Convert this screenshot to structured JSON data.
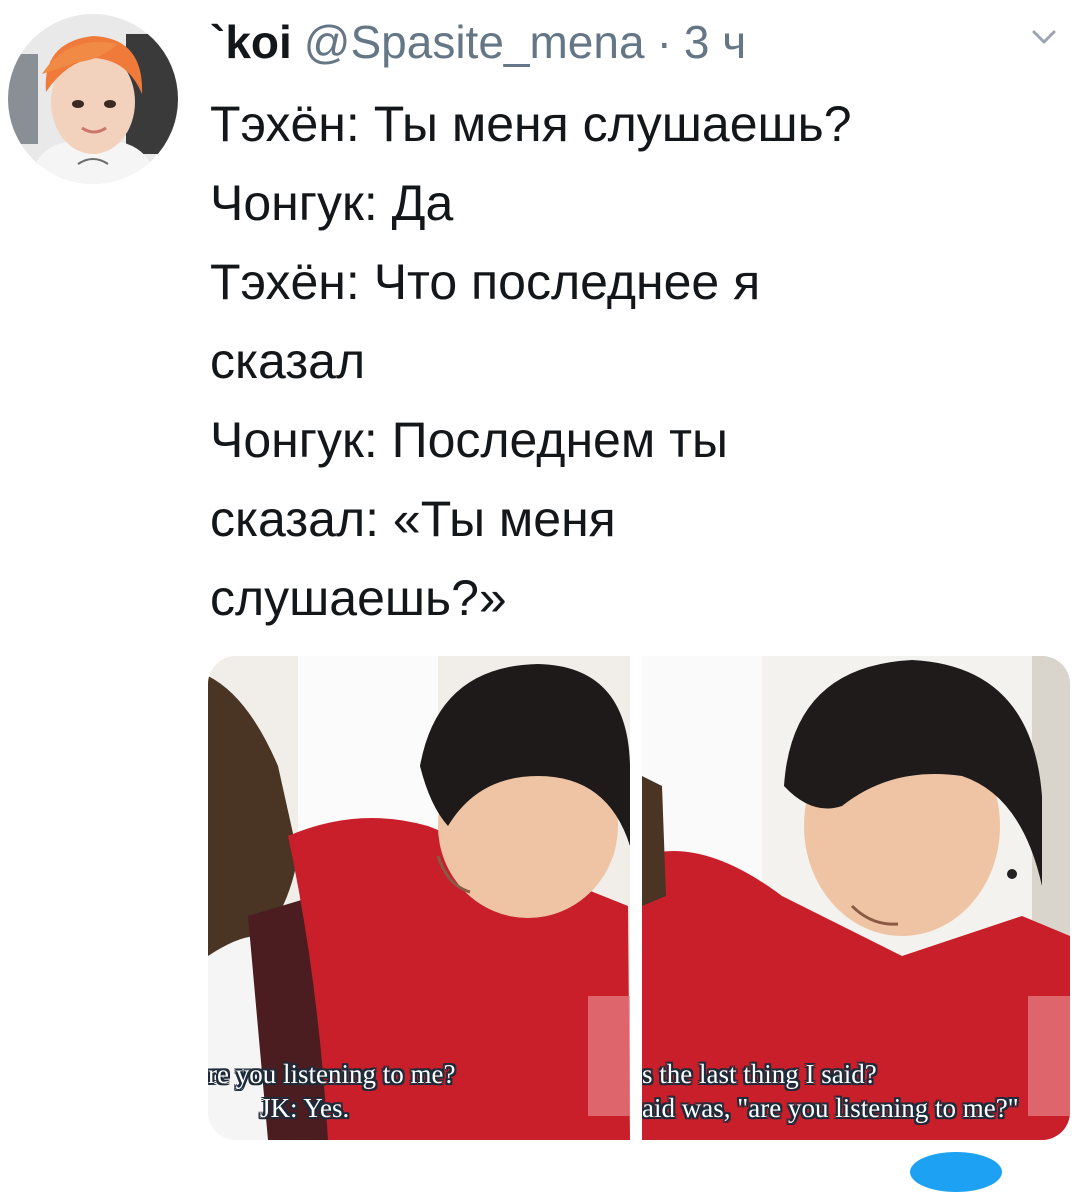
{
  "tweet": {
    "display_name": "`koi",
    "handle": "@Spasite_mena",
    "separator": "·",
    "time": "3 ч",
    "text_lines": [
      "Тэхён: Ты меня слушаешь?",
      "Чонгук: Да",
      "Тэхён: Что последнее я",
      "сказал",
      "Чонгук: Последнем ты",
      "сказал: «Ты меня",
      "слушаешь?»"
    ]
  },
  "media": {
    "panel_1_subtitles": [
      "re you listening to me?",
      "JK: Yes."
    ],
    "panel_2_subtitles": [
      "s the last thing I said?",
      "aid was, \"are you listening to me?\""
    ]
  },
  "icons": {
    "more": "chevron-down-icon"
  },
  "colors": {
    "text": "#14171a",
    "secondary": "#657786",
    "accent": "#1da1f2"
  }
}
